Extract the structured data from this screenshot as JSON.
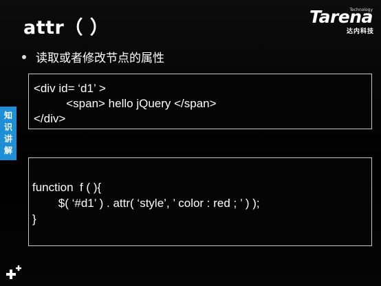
{
  "slide": {
    "title": "attr（  ）",
    "bullet": "读取或者修改节点的属性",
    "logo": {
      "brand": "Tarena",
      "tagline": "Technology",
      "chinese": "达内科技"
    },
    "side_tab": [
      "知",
      "识",
      "讲",
      "解"
    ],
    "code_html": [
      "<div id= ‘d1’ >",
      "          <span> hello jQuery </span>",
      "</div>"
    ],
    "code_js": [
      "function  f ( ){",
      "        $( ‘#d1’ ) . attr( ‘style’, ’ color : red ; ’ ) );",
      "}"
    ]
  },
  "colors": {
    "background": "#000000",
    "accent": "#1e8fd6",
    "text": "#ffffff"
  },
  "icons": {
    "corner": "plus-sparkle-icon",
    "bullet": "bullet-dot-icon"
  }
}
